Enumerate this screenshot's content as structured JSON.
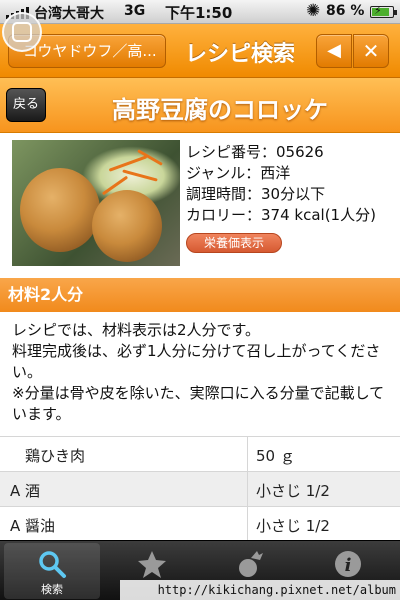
{
  "status_bar": {
    "carrier": "台湾大哥大",
    "network": "3G",
    "time": "下午1:50",
    "battery": "86 %"
  },
  "nav": {
    "back_label": "コウヤドウフ／高...",
    "title": "レシピ検索",
    "prev_symbol": "◀",
    "close_symbol": "✕"
  },
  "recipe": {
    "back_label": "戻る",
    "title": "高野豆腐のコロッケ",
    "info": [
      "レシピ番号：05626",
      "ジャンル：西洋",
      "調理時間：30分以下",
      "カロリー：374 kcal(1人分)"
    ],
    "nutrition_button": "栄養価表示"
  },
  "section": {
    "title": "材料2人分"
  },
  "note": [
    "レシピでは、材料表示は2人分です。",
    "料理完成後は、必ず1人分に分けて召し上がってください。",
    "※分量は骨や皮を除いた、実際口に入る分量で記載しています。"
  ],
  "ingredients": [
    {
      "name": "　鶏ひき肉",
      "amount": "50 ｇ"
    },
    {
      "name": "A 酒",
      "amount": "小さじ 1/2"
    },
    {
      "name": "A 醤油",
      "amount": "小さじ 1/2"
    }
  ],
  "tabs": [
    {
      "label": "検索",
      "icon": "search-icon",
      "active": true
    },
    {
      "label": "",
      "icon": "star-icon"
    },
    {
      "label": "",
      "icon": "vegetable-icon"
    },
    {
      "label": "",
      "icon": "info-icon"
    }
  ],
  "watermark": "http://kikichang.pixnet.net/album"
}
